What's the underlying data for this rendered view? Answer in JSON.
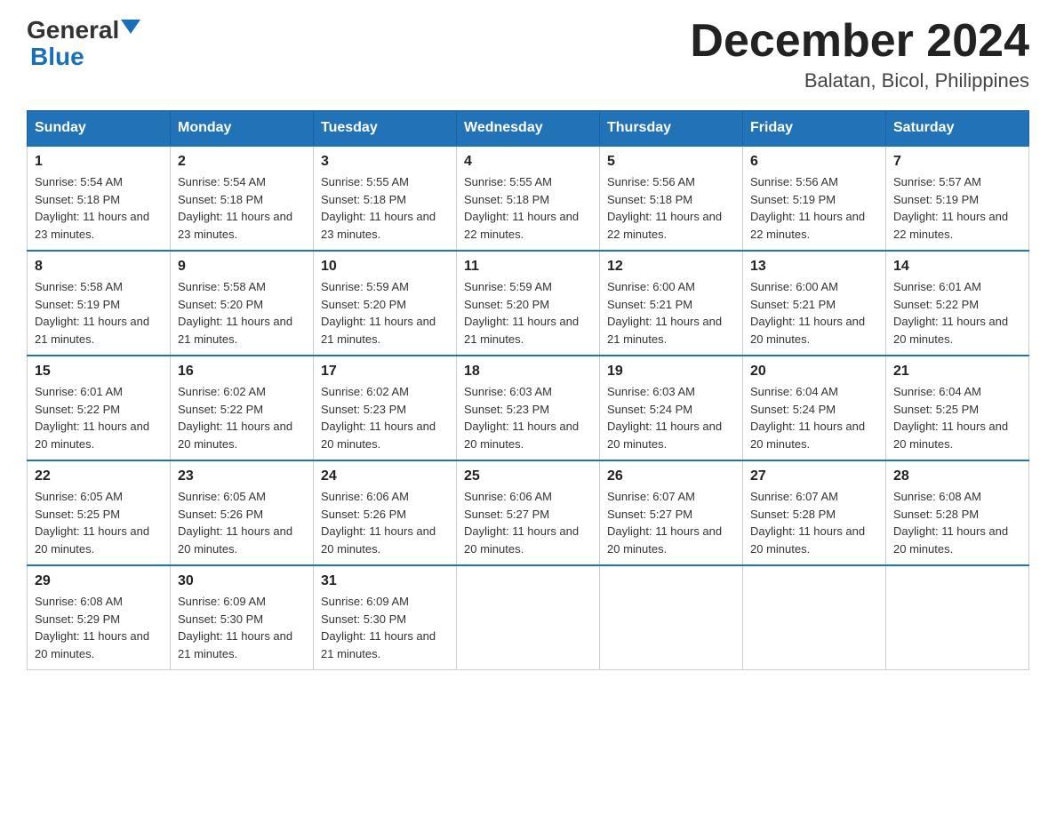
{
  "header": {
    "logo_general": "General",
    "logo_blue": "Blue",
    "month_title": "December 2024",
    "location": "Balatan, Bicol, Philippines"
  },
  "days_of_week": [
    "Sunday",
    "Monday",
    "Tuesday",
    "Wednesday",
    "Thursday",
    "Friday",
    "Saturday"
  ],
  "weeks": [
    [
      {
        "day": "1",
        "sunrise": "5:54 AM",
        "sunset": "5:18 PM",
        "daylight": "11 hours and 23 minutes."
      },
      {
        "day": "2",
        "sunrise": "5:54 AM",
        "sunset": "5:18 PM",
        "daylight": "11 hours and 23 minutes."
      },
      {
        "day": "3",
        "sunrise": "5:55 AM",
        "sunset": "5:18 PM",
        "daylight": "11 hours and 23 minutes."
      },
      {
        "day": "4",
        "sunrise": "5:55 AM",
        "sunset": "5:18 PM",
        "daylight": "11 hours and 22 minutes."
      },
      {
        "day": "5",
        "sunrise": "5:56 AM",
        "sunset": "5:18 PM",
        "daylight": "11 hours and 22 minutes."
      },
      {
        "day": "6",
        "sunrise": "5:56 AM",
        "sunset": "5:19 PM",
        "daylight": "11 hours and 22 minutes."
      },
      {
        "day": "7",
        "sunrise": "5:57 AM",
        "sunset": "5:19 PM",
        "daylight": "11 hours and 22 minutes."
      }
    ],
    [
      {
        "day": "8",
        "sunrise": "5:58 AM",
        "sunset": "5:19 PM",
        "daylight": "11 hours and 21 minutes."
      },
      {
        "day": "9",
        "sunrise": "5:58 AM",
        "sunset": "5:20 PM",
        "daylight": "11 hours and 21 minutes."
      },
      {
        "day": "10",
        "sunrise": "5:59 AM",
        "sunset": "5:20 PM",
        "daylight": "11 hours and 21 minutes."
      },
      {
        "day": "11",
        "sunrise": "5:59 AM",
        "sunset": "5:20 PM",
        "daylight": "11 hours and 21 minutes."
      },
      {
        "day": "12",
        "sunrise": "6:00 AM",
        "sunset": "5:21 PM",
        "daylight": "11 hours and 21 minutes."
      },
      {
        "day": "13",
        "sunrise": "6:00 AM",
        "sunset": "5:21 PM",
        "daylight": "11 hours and 20 minutes."
      },
      {
        "day": "14",
        "sunrise": "6:01 AM",
        "sunset": "5:22 PM",
        "daylight": "11 hours and 20 minutes."
      }
    ],
    [
      {
        "day": "15",
        "sunrise": "6:01 AM",
        "sunset": "5:22 PM",
        "daylight": "11 hours and 20 minutes."
      },
      {
        "day": "16",
        "sunrise": "6:02 AM",
        "sunset": "5:22 PM",
        "daylight": "11 hours and 20 minutes."
      },
      {
        "day": "17",
        "sunrise": "6:02 AM",
        "sunset": "5:23 PM",
        "daylight": "11 hours and 20 minutes."
      },
      {
        "day": "18",
        "sunrise": "6:03 AM",
        "sunset": "5:23 PM",
        "daylight": "11 hours and 20 minutes."
      },
      {
        "day": "19",
        "sunrise": "6:03 AM",
        "sunset": "5:24 PM",
        "daylight": "11 hours and 20 minutes."
      },
      {
        "day": "20",
        "sunrise": "6:04 AM",
        "sunset": "5:24 PM",
        "daylight": "11 hours and 20 minutes."
      },
      {
        "day": "21",
        "sunrise": "6:04 AM",
        "sunset": "5:25 PM",
        "daylight": "11 hours and 20 minutes."
      }
    ],
    [
      {
        "day": "22",
        "sunrise": "6:05 AM",
        "sunset": "5:25 PM",
        "daylight": "11 hours and 20 minutes."
      },
      {
        "day": "23",
        "sunrise": "6:05 AM",
        "sunset": "5:26 PM",
        "daylight": "11 hours and 20 minutes."
      },
      {
        "day": "24",
        "sunrise": "6:06 AM",
        "sunset": "5:26 PM",
        "daylight": "11 hours and 20 minutes."
      },
      {
        "day": "25",
        "sunrise": "6:06 AM",
        "sunset": "5:27 PM",
        "daylight": "11 hours and 20 minutes."
      },
      {
        "day": "26",
        "sunrise": "6:07 AM",
        "sunset": "5:27 PM",
        "daylight": "11 hours and 20 minutes."
      },
      {
        "day": "27",
        "sunrise": "6:07 AM",
        "sunset": "5:28 PM",
        "daylight": "11 hours and 20 minutes."
      },
      {
        "day": "28",
        "sunrise": "6:08 AM",
        "sunset": "5:28 PM",
        "daylight": "11 hours and 20 minutes."
      }
    ],
    [
      {
        "day": "29",
        "sunrise": "6:08 AM",
        "sunset": "5:29 PM",
        "daylight": "11 hours and 20 minutes."
      },
      {
        "day": "30",
        "sunrise": "6:09 AM",
        "sunset": "5:30 PM",
        "daylight": "11 hours and 21 minutes."
      },
      {
        "day": "31",
        "sunrise": "6:09 AM",
        "sunset": "5:30 PM",
        "daylight": "11 hours and 21 minutes."
      },
      null,
      null,
      null,
      null
    ]
  ]
}
